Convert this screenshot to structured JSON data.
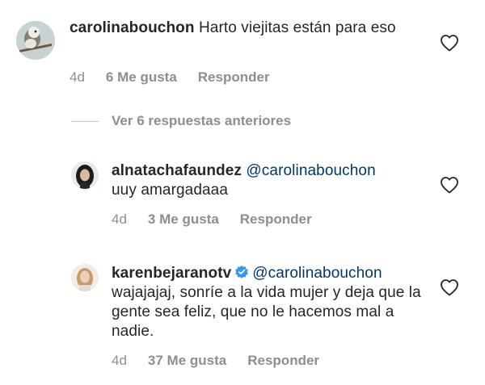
{
  "comment_main": {
    "username": "carolinabouchon",
    "text": "Harto viejitas están para eso",
    "age": "4d",
    "likes": "6 Me gusta",
    "reply": "Responder"
  },
  "view_replies": "Ver 6 respuestas anteriores",
  "reply_1": {
    "username": "alnatachafaundez",
    "mention": "@carolinabouchon",
    "text": "uuy amargadaaa",
    "age": "4d",
    "likes": "3 Me gusta",
    "reply": "Responder"
  },
  "reply_2": {
    "username": "karenbejaranotv",
    "mention": "@carolinabouchon",
    "text": "wajajajaj, sonríe a la vida mujer y deja que la gente sea feliz, que no le hacemos mal a nadie.",
    "age": "4d",
    "likes": "37 Me gusta",
    "reply": "Responder"
  },
  "colors": {
    "text": "#262626",
    "secondary": "#8e8e8e",
    "mention": "#00376b",
    "verified": "#3897f0"
  }
}
